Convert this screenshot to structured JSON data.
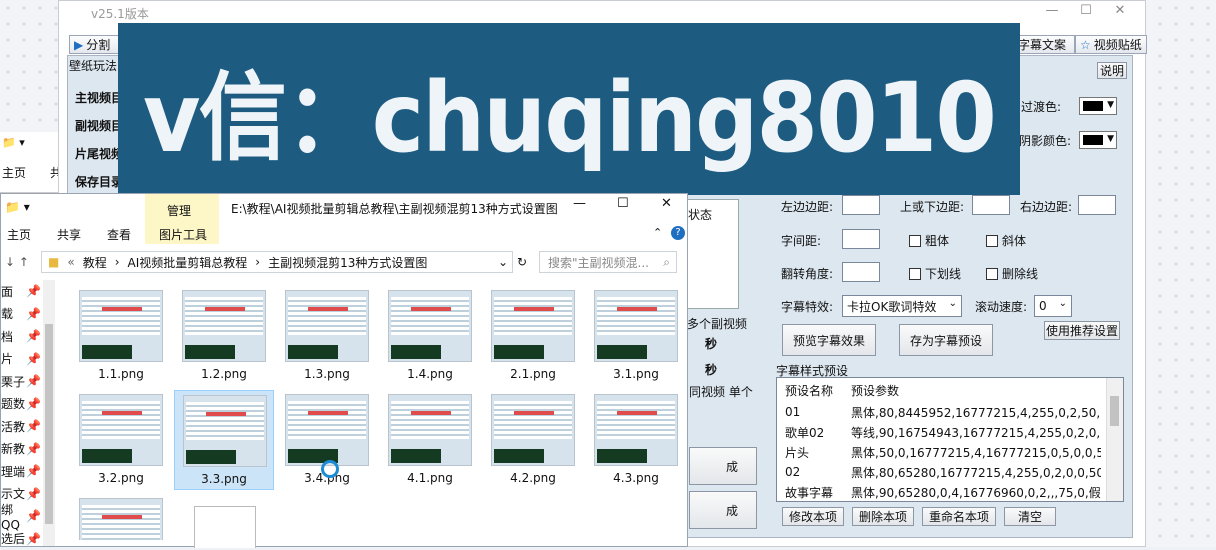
{
  "app": {
    "title": "v25.1版本",
    "tabs": [
      "分割",
      "壁纸玩法",
      "字幕文案",
      "视频贴纸"
    ],
    "help_button": "说明",
    "side_labels": [
      "主视频目",
      "副视频目",
      "片尾视频",
      "保存目录"
    ],
    "color_labels": [
      "过渡色:",
      "阴影颜色:"
    ],
    "status_label": "状态",
    "mid_labels": [
      "多个副视频",
      "秒",
      "秒",
      "同视频 单个",
      "成",
      "成"
    ]
  },
  "subtitle_settings": {
    "left_margin": "左边边距:",
    "top_bottom_margin": "上或下边距:",
    "right_margin": "右边边距:",
    "letter_spacing": "字间距:",
    "bold": "粗体",
    "italic": "斜体",
    "rotate_angle": "翻转角度:",
    "underline": "下划线",
    "strikethrough": "删除线",
    "effect_label": "字幕特效:",
    "effect_value": "卡拉OK歌词特效",
    "scroll_speed_label": "滚动速度:",
    "scroll_speed_value": "0",
    "preview_button": "预览字幕效果",
    "save_preset_button": "存为字幕预设",
    "recommended_button": "使用推荐设置"
  },
  "presets": {
    "section_title": "字幕样式预设",
    "col_name": "预设名称",
    "col_params": "预设参数",
    "rows": [
      {
        "name": "01",
        "params": "黑体,80,8445952,16777215,4,255,0,2,50,0,..."
      },
      {
        "name": "歌单02",
        "params": "等线,90,16754943,16777215,4,255,0,2,0,0,..."
      },
      {
        "name": "片头",
        "params": "黑体,50,0,16777215,4,16777215,0,5,0,0,50,..."
      },
      {
        "name": "02",
        "params": "黑体,80,65280,16777215,4,255,0,2,0,0,50,3..."
      },
      {
        "name": "故事字幕",
        "params": "黑体,90,65280,0,4,16776960,0,2,,,75,0,假,..."
      }
    ],
    "buttons": [
      "修改本项",
      "删除本项",
      "重命名本项",
      "清空"
    ]
  },
  "watermark": {
    "text": "v信：chuqing8010",
    "color": "#1d5b80"
  },
  "explorer": {
    "path_title": "E:\\教程\\AI视频批量剪辑总教程\\主副视频混剪13种方式设置图",
    "context_tab": "管理",
    "ribbon": [
      "主页",
      "共享",
      "查看",
      "图片工具"
    ],
    "breadcrumb": [
      "教程",
      "AI视频批量剪辑总教程",
      "主副视频混剪13种方式设置图"
    ],
    "search_placeholder": "搜索\"主副视频混...",
    "nav_items": [
      "面",
      "载",
      "档",
      "片",
      "栗子",
      "题数",
      "活教",
      "新教",
      "理端",
      "示文",
      "绑QQ",
      "选后"
    ],
    "files": [
      "1.1.png",
      "1.2.png",
      "1.3.png",
      "1.4.png",
      "2.1.png",
      "3.1.png",
      "3.2.png",
      "3.3.png",
      "3.4.png",
      "4.1.png",
      "4.2.png",
      "4.3.png"
    ],
    "selected_file": "3.3.png"
  },
  "back_window": {
    "ribbon": [
      "主页",
      "共"
    ]
  }
}
